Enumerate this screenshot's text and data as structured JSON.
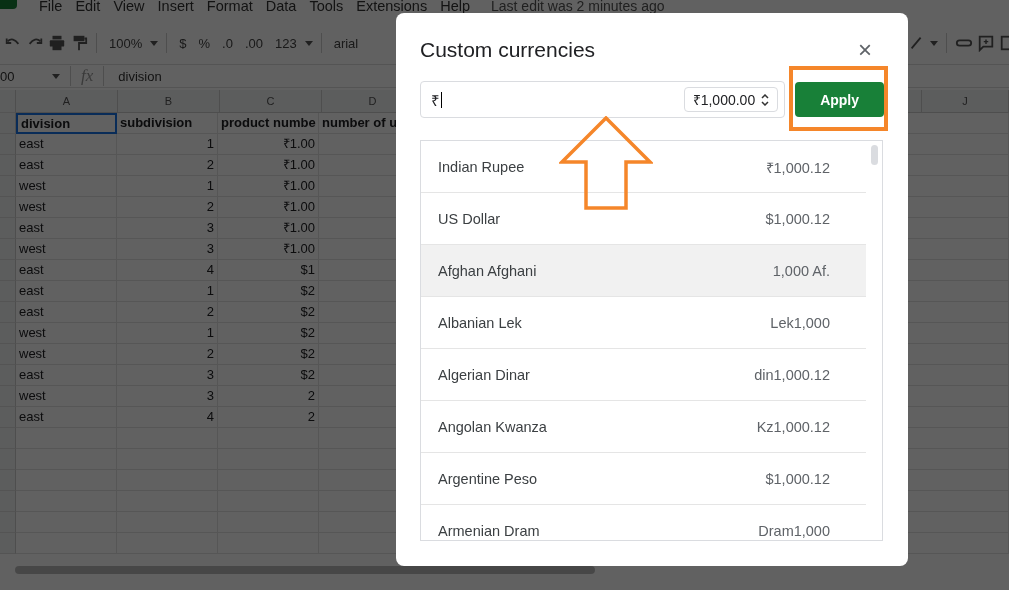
{
  "menu_bar": {
    "items": [
      "File",
      "Edit",
      "View",
      "Insert",
      "Format",
      "Data",
      "Tools",
      "Extensions",
      "Help"
    ],
    "last_edit": "Last edit was 2 minutes ago"
  },
  "toolbar": {
    "zoom": "100%",
    "currency": "$",
    "percent": "%",
    "decrease_decimal": ".0",
    "increase_decimal": ".00",
    "more_formats": "123",
    "font": "arial"
  },
  "formula_bar": {
    "name_box": "00",
    "function_label": "fx",
    "value": "division"
  },
  "sheet": {
    "columns": [
      "A",
      "B",
      "C",
      "D",
      "J"
    ],
    "header_row": [
      "division",
      "subdivision",
      "product numbe",
      "number of u"
    ],
    "rows": [
      [
        "east",
        "1",
        "₹1.00"
      ],
      [
        "east",
        "2",
        "₹1.00"
      ],
      [
        "west",
        "1",
        "₹1.00"
      ],
      [
        "west",
        "2",
        "₹1.00"
      ],
      [
        "east",
        "3",
        "₹1.00"
      ],
      [
        "west",
        "3",
        "₹1.00"
      ],
      [
        "east",
        "4",
        "$1"
      ],
      [
        "east",
        "1",
        "$2"
      ],
      [
        "east",
        "2",
        "$2"
      ],
      [
        "west",
        "1",
        "$2"
      ],
      [
        "west",
        "2",
        "$2"
      ],
      [
        "east",
        "3",
        "$2"
      ],
      [
        "west",
        "3",
        "2"
      ],
      [
        "east",
        "4",
        "2"
      ]
    ]
  },
  "dialog": {
    "title": "Custom currencies",
    "close": "×",
    "symbol_value": "₹",
    "format_select": "₹1,000.00",
    "apply": "Apply",
    "currencies": [
      {
        "name": "Indian Rupee",
        "example": "₹1,000.12",
        "selected": false
      },
      {
        "name": "US Dollar",
        "example": "$1,000.12",
        "selected": false
      },
      {
        "name": "Afghan Afghani",
        "example": "1,000 Af.",
        "selected": true
      },
      {
        "name": "Albanian Lek",
        "example": "Lek1,000",
        "selected": false
      },
      {
        "name": "Algerian Dinar",
        "example": "din1,000.12",
        "selected": false
      },
      {
        "name": "Angolan Kwanza",
        "example": "Kz1,000.12",
        "selected": false
      },
      {
        "name": "Argentine Peso",
        "example": "$1,000.12",
        "selected": false
      },
      {
        "name": "Armenian Dram",
        "example": "Dram1,000",
        "selected": false
      }
    ]
  }
}
